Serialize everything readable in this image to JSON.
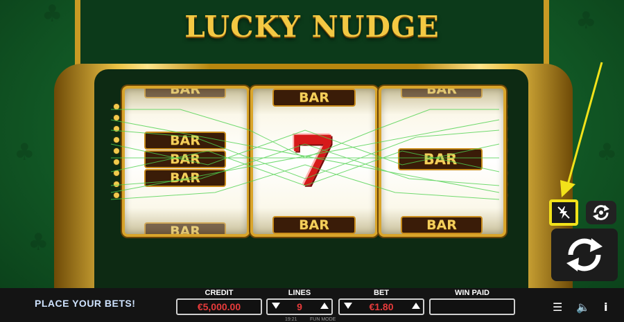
{
  "game": {
    "title": "LUCKY NUDGE"
  },
  "reels": [
    {
      "symbols": [
        "BAR",
        "BAR",
        "BAR",
        "BAR",
        "BAR"
      ]
    },
    {
      "symbols": [
        "BAR",
        "7",
        "BAR"
      ]
    },
    {
      "symbols": [
        "BAR",
        "BAR",
        "BAR"
      ]
    }
  ],
  "status": {
    "message": "PLACE YOUR BETS!"
  },
  "credit": {
    "label": "CREDIT",
    "value": "€5,000.00"
  },
  "lines": {
    "label": "LINES",
    "value": "9"
  },
  "bet": {
    "label": "BET",
    "value": "€1.80"
  },
  "win_paid": {
    "label": "WIN PAID",
    "value": ""
  },
  "footer": {
    "clock": "19:21",
    "mode": "FUN MODE"
  },
  "controls": {
    "turbo_icon": "turbo-lightning-icon",
    "autoplay_icon": "autoplay-refresh-icon",
    "spin_icon": "spin-refresh-icon",
    "menu_icon": "menu-icon",
    "sound_icon": "speaker-icon",
    "info_icon": "info-icon"
  },
  "colors": {
    "background_green": "#125a26",
    "gold": "#e9c043",
    "value_red": "#e83b3b",
    "highlight_yellow": "#f2e21a",
    "status_text": "#cfe3ff"
  }
}
